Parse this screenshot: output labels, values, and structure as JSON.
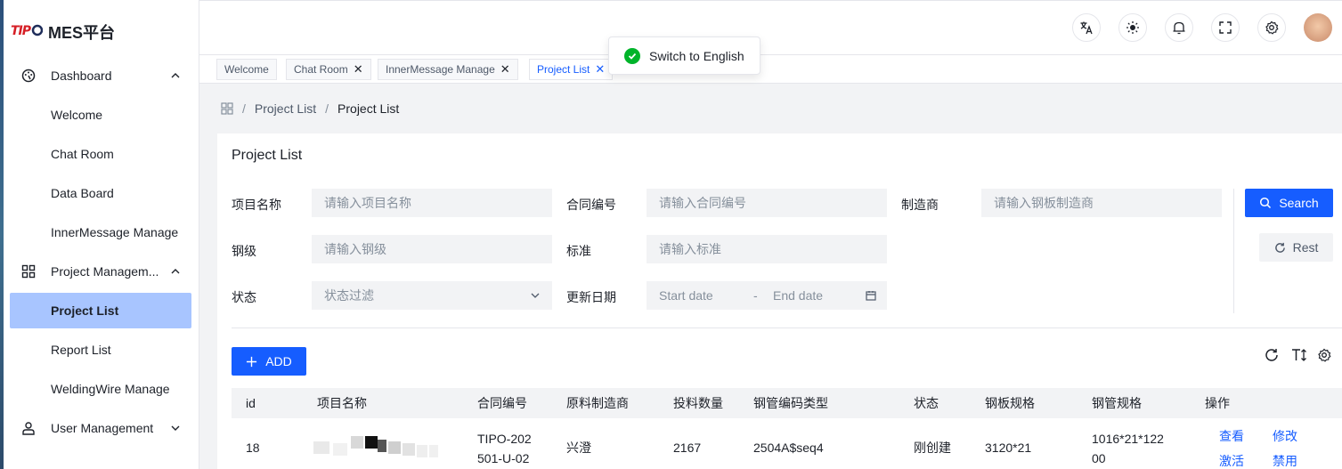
{
  "sidebar": {
    "logo_mark": "TIPO",
    "logo_text": "MES平台",
    "items": [
      {
        "label": "Dashboard"
      },
      {
        "label": "Welcome"
      },
      {
        "label": "Chat Room"
      },
      {
        "label": "Data Board"
      },
      {
        "label": "InnerMessage Manage"
      },
      {
        "label": "Project Managem..."
      },
      {
        "label": "Project List"
      },
      {
        "label": "Report List"
      },
      {
        "label": "WeldingWire Manage"
      },
      {
        "label": "User Management"
      }
    ]
  },
  "tabs": [
    {
      "label": "Welcome"
    },
    {
      "label": "Chat Room"
    },
    {
      "label": "InnerMessage Manage"
    },
    {
      "label": "Project List"
    }
  ],
  "toast": {
    "text": "Switch to English"
  },
  "breadcrumb": {
    "parent": "Project List",
    "current": "Project List"
  },
  "card": {
    "title": "Project List"
  },
  "filters": {
    "project_name": {
      "label": "项目名称",
      "placeholder": "请输入项目名称"
    },
    "contract_no": {
      "label": "合同编号",
      "placeholder": "请输入合同编号"
    },
    "manufacturer": {
      "label": "制造商",
      "placeholder": "请输入钢板制造商"
    },
    "steel_grade": {
      "label": "钢级",
      "placeholder": "请输入钢级"
    },
    "standard": {
      "label": "标准",
      "placeholder": "请输入标准"
    },
    "status": {
      "label": "状态",
      "placeholder": "状态过滤"
    },
    "update_date": {
      "label": "更新日期",
      "start": "Start date",
      "dash": "-",
      "end": "End date"
    },
    "search_label": "Search",
    "reset_label": "Rest"
  },
  "toolbar": {
    "add_label": "ADD"
  },
  "table": {
    "columns": [
      "id",
      "项目名称",
      "合同编号",
      "原料制造商",
      "投料数量",
      "钢管编码类型",
      "状态",
      "钢板规格",
      "钢管规格",
      "操作"
    ],
    "rows": [
      {
        "id": "18",
        "contract_line1": "TIPO-202",
        "contract_line2": "501-U-02",
        "manufacturer": "兴澄",
        "quantity": "2167",
        "code_type": "2504A$seq4",
        "status": "刚创建",
        "plate_spec": "3120*21",
        "pipe_line1": "1016*21*122",
        "pipe_line2": "00",
        "actions": [
          "查看",
          "修改",
          "激活",
          "禁用"
        ]
      }
    ]
  },
  "colors": {
    "primary": "#165dff",
    "active_menu": "#a8c5ff",
    "success": "#00b42a"
  }
}
